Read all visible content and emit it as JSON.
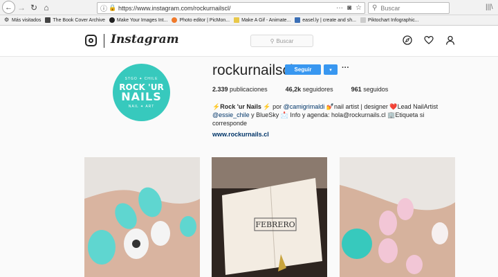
{
  "browser": {
    "url": "https://www.instagram.com/rockurnailscl/",
    "search_placeholder": "Buscar",
    "bookmarks": [
      {
        "label": "Más visitados",
        "color": "#777777"
      },
      {
        "label": "The Book Cover Archive",
        "color": "#444444"
      },
      {
        "label": "Make Your Images Int...",
        "color": "#222222"
      },
      {
        "label": "Photo editor | PicMon...",
        "color": "#f07a2b"
      },
      {
        "label": "Make A Gif - Animate...",
        "color": "#e8c84a"
      },
      {
        "label": "easel.ly | create and sh...",
        "color": "#3b6fb6"
      },
      {
        "label": "Piktochart Infographic...",
        "color": "#cccccc"
      }
    ]
  },
  "header": {
    "logo_text": "Instagram",
    "search_placeholder": "Buscar",
    "icons": [
      "compass-icon",
      "heart-icon",
      "user-icon"
    ]
  },
  "profile": {
    "avatar": {
      "top": "STGO ✦ CHILE",
      "line1": "ROCK 'UR",
      "line2": "NAILS",
      "bottom": "NAIL ✦ ART"
    },
    "username": "rockurnailscl",
    "follow_label": "Seguir",
    "dropdown_label": "▾",
    "more_label": "···",
    "stats": [
      {
        "value": "2.339",
        "label": "publicaciones"
      },
      {
        "value": "46,2k",
        "label": "seguidores"
      },
      {
        "value": "961",
        "label": "seguidos"
      }
    ],
    "bio": {
      "line1_a": "⚡",
      "name": "Rock 'ur Nails",
      "line1_b": "⚡ por ",
      "mention1": "@camigrimaldi",
      "line1_c": " 💅nail artist | designer ❤️Lead NailArtist",
      "mention2": "@essie_chile",
      "line2": " y BlueSky 📩 Info y agenda: hola@rockurnails.cl 🏢Etiqueta si corresponde"
    },
    "website": "www.rockurnails.cl"
  },
  "colors": {
    "accent": "#3897f0",
    "avatar_bg": "#37c9bd",
    "link": "#003569"
  }
}
